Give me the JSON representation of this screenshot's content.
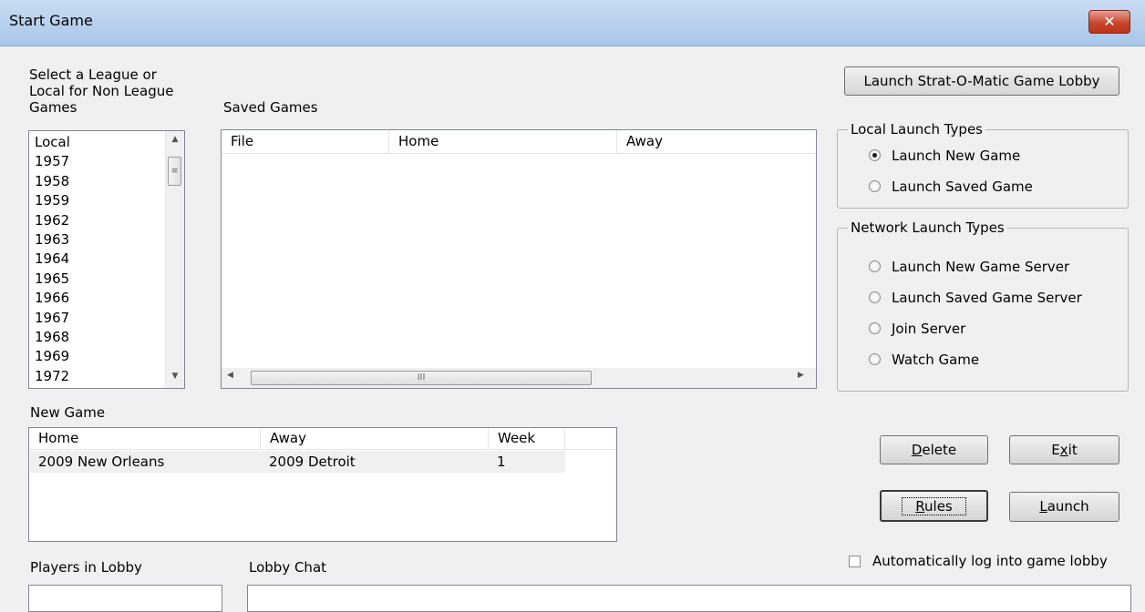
{
  "window": {
    "title": "Start Game",
    "close_glyph": "✕"
  },
  "league": {
    "label_lines": [
      "Select a League or",
      "Local for Non League",
      "Games"
    ],
    "items": [
      "Local",
      "1957",
      "1958",
      "1959",
      "1962",
      "1963",
      "1964",
      "1965",
      "1966",
      "1967",
      "1968",
      "1969",
      "1972"
    ]
  },
  "saved_games": {
    "label": "Saved Games",
    "columns": [
      "File",
      "Home",
      "Away"
    ],
    "scroll_thumb_glyph": "III"
  },
  "lobby_button": "Launch Strat-O-Matic Game Lobby",
  "local_launch": {
    "title": "Local Launch Types",
    "options": [
      {
        "label": "Launch New Game",
        "selected": true
      },
      {
        "label": "Launch Saved Game",
        "selected": false
      }
    ]
  },
  "network_launch": {
    "title": "Network Launch Types",
    "options": [
      {
        "label": "Launch New Game Server",
        "selected": false
      },
      {
        "label": "Launch Saved Game Server",
        "selected": false
      },
      {
        "label": "Join Server",
        "selected": false
      },
      {
        "label": "Watch Game",
        "selected": false
      }
    ]
  },
  "new_game": {
    "label": "New Game",
    "columns": [
      "Home",
      "Away",
      "Week"
    ],
    "rows": [
      {
        "home": "2009 New Orleans",
        "away": "2009 Detroit",
        "week": "1"
      }
    ]
  },
  "buttons": {
    "delete": {
      "mnemonic": "D",
      "rest": "elete"
    },
    "exit": {
      "pre": "E",
      "mnemonic": "x",
      "rest": "it"
    },
    "rules": {
      "mnemonic": "R",
      "rest": "ules"
    },
    "launch": {
      "mnemonic": "L",
      "rest": "aunch"
    }
  },
  "auto_login": {
    "label": "Automatically log into game lobby",
    "checked": false
  },
  "players_in_lobby": {
    "label": "Players in Lobby"
  },
  "lobby_chat": {
    "label": "Lobby Chat"
  }
}
